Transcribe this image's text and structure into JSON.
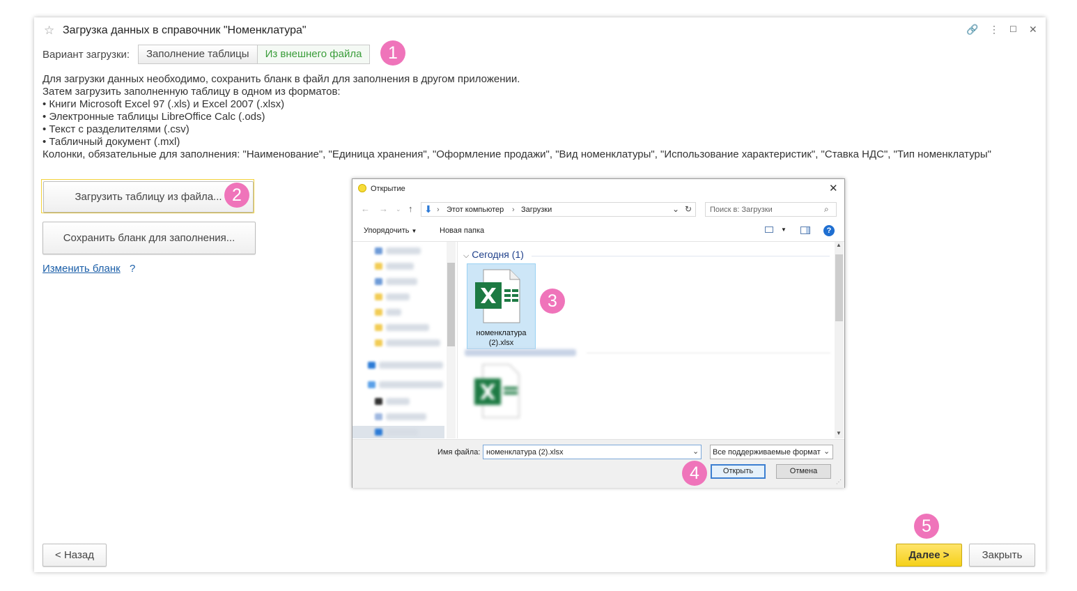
{
  "window": {
    "title": "Загрузка данных в справочник \"Номенклатура\"",
    "controls": [
      "🔗",
      "⋮",
      "☐",
      "✕"
    ]
  },
  "variant": {
    "label": "Вариант загрузки:",
    "options": [
      "Заполнение таблицы",
      "Из внешнего файла"
    ],
    "selected": "Из внешнего файла"
  },
  "description": [
    "Для загрузки данных необходимо, сохранить бланк в файл для заполнения в другом приложении.",
    "Затем загрузить заполненную таблицу в одном из форматов:",
    "• Книги Microsoft Excel 97 (.xls) и Excel 2007 (.xlsx)",
    "• Электронные таблицы LibreOffice Calc (.ods)",
    "• Текст с разделителями (.csv)",
    "• Табличный документ (.mxl)",
    "Колонки, обязательные для заполнения: \"Наименование\", \"Единица хранения\", \"Оформление продажи\", \"Вид номенклатуры\", \"Использование характеристик\", \"Ставка НДС\", \"Тип номенклатуры\""
  ],
  "actions": {
    "load_button": "Загрузить таблицу из файла...",
    "save_button": "Сохранить бланк для заполнения...",
    "change_link": "Изменить бланк",
    "help": "?"
  },
  "footer": {
    "back": "< Назад",
    "next": "Далее >",
    "close": "Закрыть"
  },
  "badges": [
    "1",
    "2",
    "3",
    "4",
    "5"
  ],
  "dialog": {
    "title": "Открытие",
    "address": [
      "Этот компьютер",
      "Загрузки"
    ],
    "search_placeholder": "Поиск в: Загрузки",
    "organize": "Упорядочить",
    "new_folder": "Новая папка",
    "group": "Сегодня (1)",
    "file_name_line1": "номенклатура",
    "file_name_line2": "(2).xlsx",
    "filename_label": "Имя файла:",
    "filename_value": "номенклатура (2).xlsx",
    "filter": "Все поддерживаемые формат",
    "open": "Открыть",
    "cancel": "Отмена"
  },
  "colors": {
    "accent_green": "#3a9d3a",
    "badge_pink": "#ef74ba",
    "next_yellow": "#f5d11b",
    "link_blue": "#1a5ea8",
    "excel_green": "#1d7a43"
  }
}
